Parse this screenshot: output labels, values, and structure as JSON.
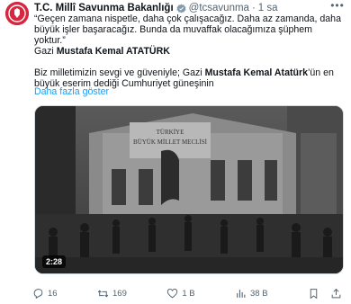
{
  "account": {
    "display_name": "T.C. Millî Savunma Bakanlığı",
    "handle": "@tcsavunma",
    "separator": "·",
    "time": "1 sa"
  },
  "tweet": {
    "line1": "“Geçen zamana nispetle, daha çok çalışacağız. Daha az zamanda, daha",
    "line2": "büyük işler başaracağız. Bunda da muvaffak olacağımıza şüphem yoktur.”",
    "signature_prefix": "Gazi ",
    "signature_bold": "Mustafa Kemal ATATÜRK",
    "line4_prefix": "Biz milletimizin sevgi ve güveniyle; Gazi ",
    "line4_bold": "Mustafa Kemal Atatürk",
    "line4_suffix": "’ün en",
    "line5": "büyük eserim dediği Cumhuriyet güneşinin",
    "show_more": "Daha fazla göster"
  },
  "media": {
    "building_sign_line1": "TÜRKİYE",
    "building_sign_line2": "BÜYÜK MİLLET MECLİSİ",
    "duration": "2:28"
  },
  "actions": {
    "reply_count": "16",
    "retweet_count": "169",
    "like_count": "1 B",
    "views_count": "38 B"
  },
  "colors": {
    "accent": "#1d9bf0",
    "muted": "#536471",
    "avatar": "#d7263d",
    "verified_gray": "#829aab"
  }
}
